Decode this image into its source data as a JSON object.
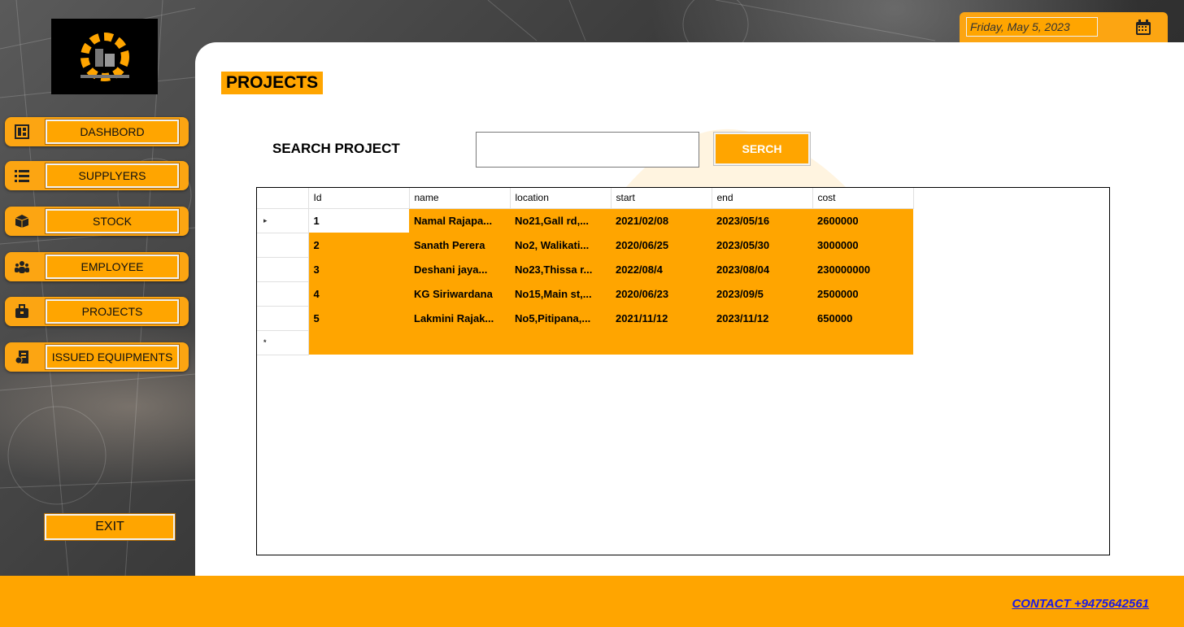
{
  "date": "Friday, May 5, 2023",
  "page_title": "PROJECTS",
  "sidebar": {
    "items": [
      {
        "label": "DASHBORD",
        "icon": "dashboard-icon"
      },
      {
        "label": "SUPPLYERS",
        "icon": "list-icon"
      },
      {
        "label": "STOCK",
        "icon": "boxes-icon"
      },
      {
        "label": "EMPLOYEE",
        "icon": "people-icon"
      },
      {
        "label": "PROJECTS",
        "icon": "briefcase-icon"
      },
      {
        "label": "ISSUED EQUIPMENTS",
        "icon": "invoice-icon"
      }
    ],
    "exit_label": "EXIT"
  },
  "search": {
    "label": "SEARCH PROJECT",
    "value": "",
    "button_label": "SERCH"
  },
  "grid": {
    "columns": [
      "Id",
      "name",
      "location",
      "start",
      "end",
      "cost"
    ],
    "rows": [
      {
        "id": "1",
        "name": "Namal Rajapa...",
        "location": "No21,Gall rd,...",
        "start": "2021/02/08",
        "end": "2023/05/16",
        "cost": "2600000"
      },
      {
        "id": "2",
        "name": "Sanath Perera",
        "location": "No2, Walikati...",
        "start": "2020/06/25",
        "end": "2023/05/30",
        "cost": "3000000"
      },
      {
        "id": "3",
        "name": "Deshani jaya...",
        "location": "No23,Thissa r...",
        "start": "2022/08/4",
        "end": "2023/08/04",
        "cost": "230000000"
      },
      {
        "id": "4",
        "name": "KG Siriwardana",
        "location": "No15,Main st,...",
        "start": "2020/06/23",
        "end": "2023/09/5",
        "cost": "2500000"
      },
      {
        "id": "5",
        "name": "Lakmini Rajak...",
        "location": "No5,Pitipana,...",
        "start": "2021/11/12",
        "end": "2023/11/12",
        "cost": "650000"
      }
    ],
    "current_row_marker": "▸",
    "new_row_marker": "*"
  },
  "footer": {
    "contact": "CONTACT +9475642561"
  },
  "colors": {
    "accent": "#ffa500",
    "link": "#1a1ae6"
  }
}
